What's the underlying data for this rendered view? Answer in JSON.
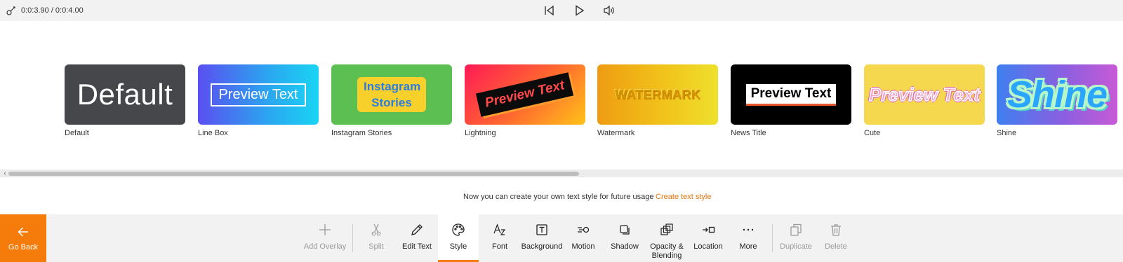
{
  "playback": {
    "time": "0:0:3.90 / 0:0:4.00",
    "icons": [
      "scrub-icon",
      "skip-to-start-icon",
      "play-icon",
      "volume-icon"
    ]
  },
  "styles": [
    {
      "label": "Default",
      "preview": "Default"
    },
    {
      "label": "Line Box",
      "preview": "Preview Text"
    },
    {
      "label": "Instagram Stories",
      "preview": "Instagram Stories"
    },
    {
      "label": "Lightning",
      "preview": "Preview Text"
    },
    {
      "label": "Watermark",
      "preview": "WATERMARK"
    },
    {
      "label": "News Title",
      "preview": "Preview Text"
    },
    {
      "label": "Cute",
      "preview": "Preview Text"
    },
    {
      "label": "Shine",
      "preview": "Shine"
    }
  ],
  "info": {
    "text": "Now you can create your own text style for future usage",
    "link": "Create text style"
  },
  "toolbar": {
    "go_back": "Go Back",
    "tools": [
      {
        "label": "Add Overlay",
        "icon": "plus-icon",
        "disabled": true
      },
      {
        "label": "Split",
        "icon": "scissors-icon",
        "disabled": true
      },
      {
        "label": "Edit Text",
        "icon": "pencil-icon",
        "disabled": false
      },
      {
        "label": "Style",
        "icon": "palette-icon",
        "disabled": false,
        "selected": true
      },
      {
        "label": "Font",
        "icon": "font-icon",
        "disabled": false
      },
      {
        "label": "Background",
        "icon": "text-box-icon",
        "disabled": false
      },
      {
        "label": "Motion",
        "icon": "motion-icon",
        "disabled": false
      },
      {
        "label": "Shadow",
        "icon": "shadow-icon",
        "disabled": false
      },
      {
        "label": "Opacity & Blending",
        "icon": "opacity-icon",
        "disabled": false
      },
      {
        "label": "Location",
        "icon": "location-icon",
        "disabled": false
      },
      {
        "label": "More",
        "icon": "more-icon",
        "disabled": false
      },
      {
        "label": "Duplicate",
        "icon": "duplicate-icon",
        "disabled": true
      },
      {
        "label": "Delete",
        "icon": "trash-icon",
        "disabled": true
      }
    ]
  },
  "colors": {
    "accent": "#f57c0a",
    "link": "#e8750a"
  }
}
